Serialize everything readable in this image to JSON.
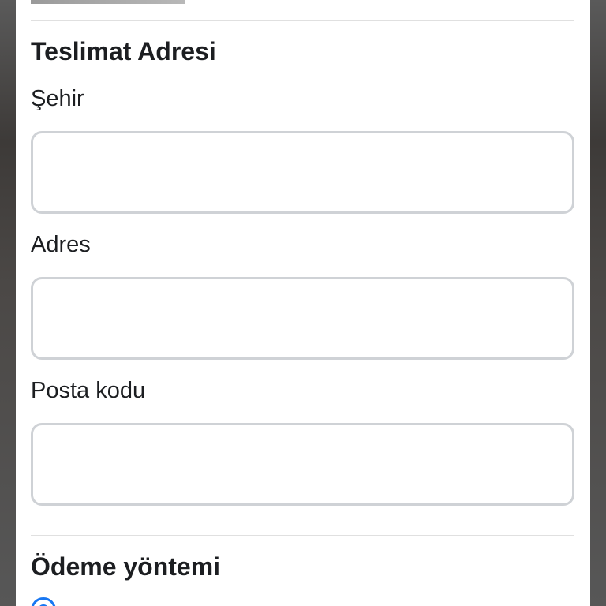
{
  "delivery_address": {
    "title": "Teslimat Adresi",
    "fields": [
      {
        "label": "Şehir",
        "value": "",
        "placeholder": ""
      },
      {
        "label": "Adres",
        "value": "",
        "placeholder": ""
      },
      {
        "label": "Posta kodu",
        "value": "",
        "placeholder": ""
      }
    ]
  },
  "payment_method": {
    "title": "Ödeme yöntemi"
  },
  "colors": {
    "sheet_background": "#ffffff",
    "text": "#1c1e21",
    "field_border": "#cfd2d6",
    "divider": "#e0e0e0",
    "radio_accent": "#1877f2"
  }
}
